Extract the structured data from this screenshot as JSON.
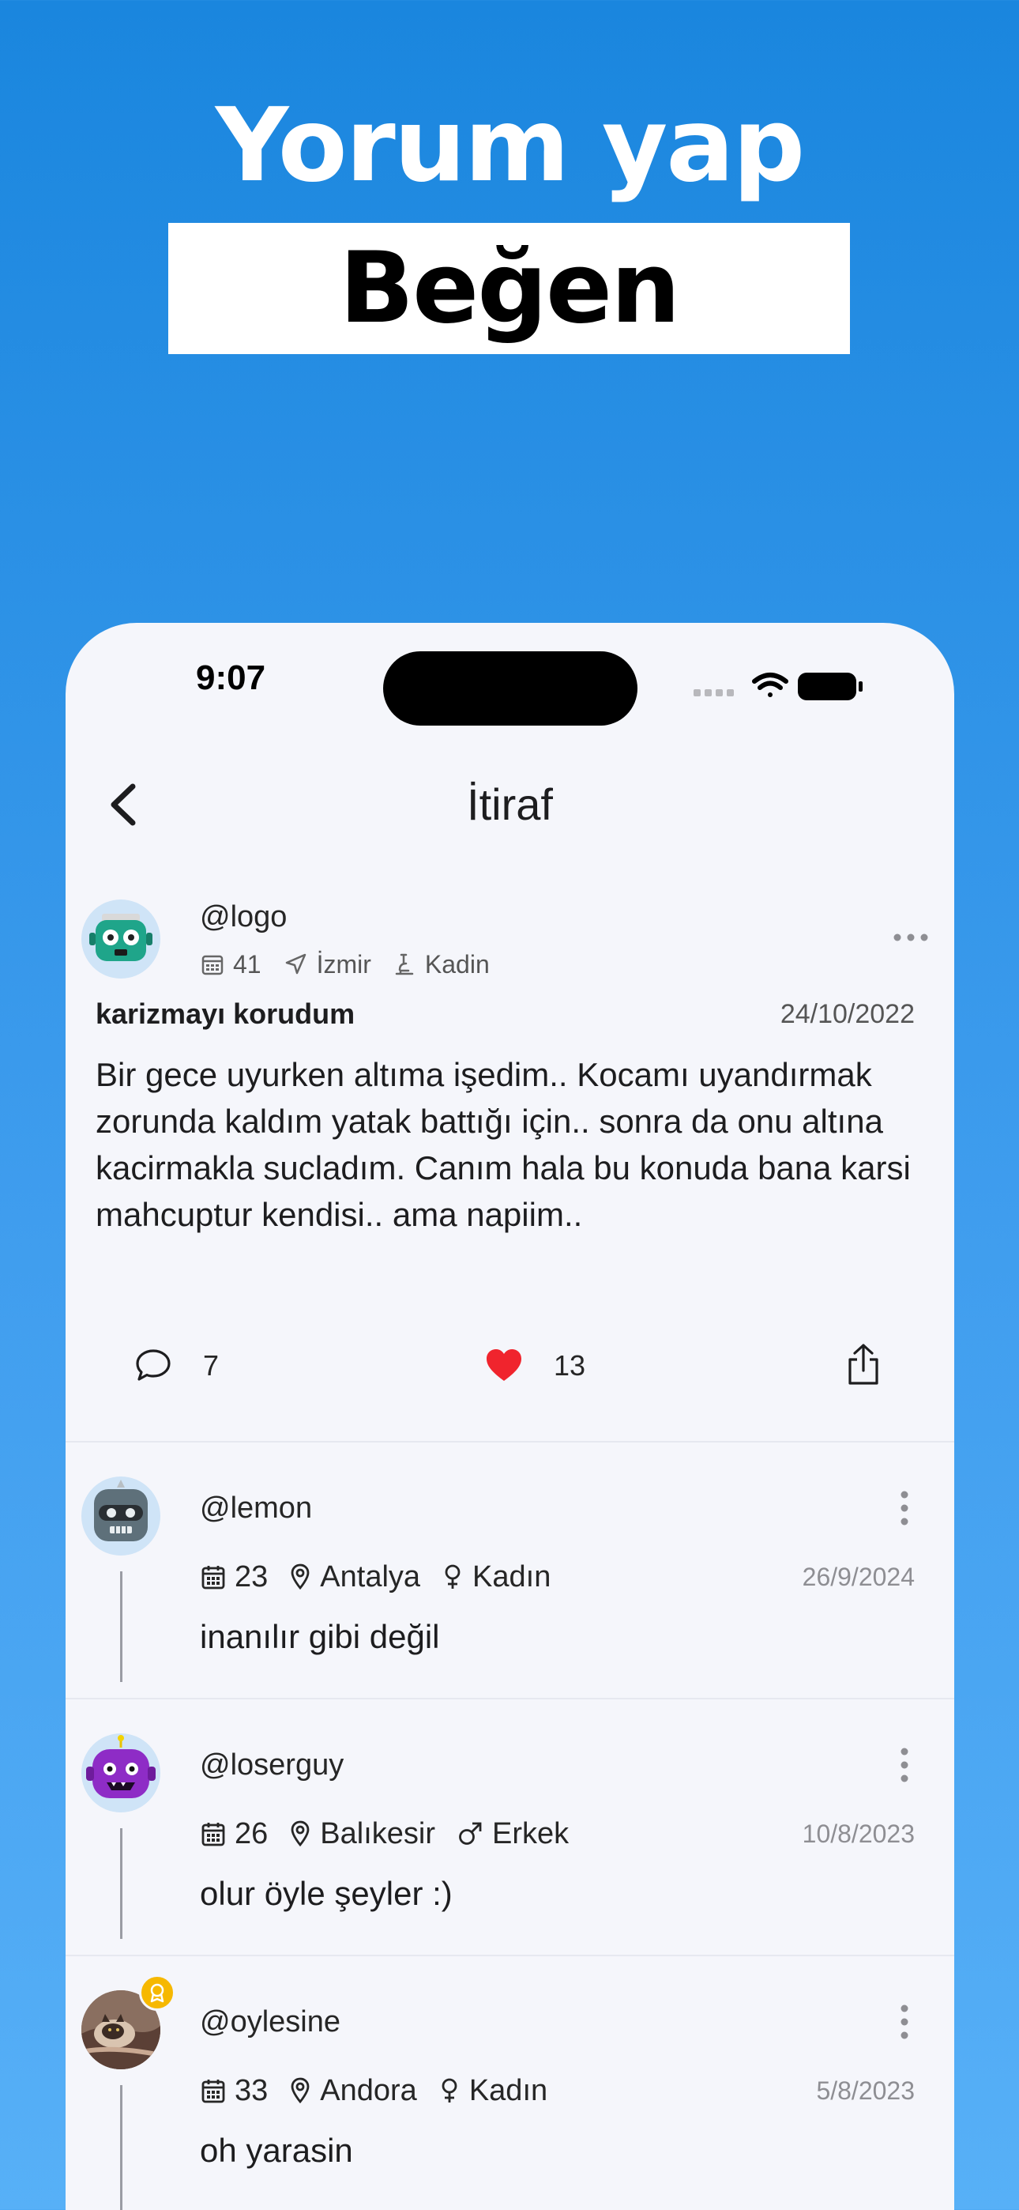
{
  "promo": {
    "title": "Yorum yap",
    "subtitle": "Beğen"
  },
  "status_bar": {
    "time": "9:07"
  },
  "nav": {
    "title": "İtiraf"
  },
  "post": {
    "username": "@logo",
    "age": "41",
    "city": "İzmir",
    "gender": "Kadin",
    "title": "karizmayı korudum",
    "date": "24/10/2022",
    "body": "Bir gece uyurken altıma işedim.. Kocamı uyandırmak zorunda kaldım yatak battığı için.. sonra da onu altına kacirmakla sucladım. Canım hala bu konuda bana karsi mahcuptur kendisi.. ama napiim..",
    "comment_count": "7",
    "like_count": "13",
    "like_color": "#f0242d"
  },
  "comments": [
    {
      "username": "@lemon",
      "age": "23",
      "city": "Antalya",
      "gender": "Kadın",
      "date": "26/9/2024",
      "text": "inanılır gibi değil",
      "gender_icon": "female-icon"
    },
    {
      "username": "@loserguy",
      "age": "26",
      "city": "Balıkesir",
      "gender": "Erkek",
      "date": "10/8/2023",
      "text": "olur öyle şeyler :)",
      "gender_icon": "male-icon"
    },
    {
      "username": "@oylesine",
      "age": "33",
      "city": "Andora",
      "gender": "Kadın",
      "date": "5/8/2023",
      "text": "oh yarasin",
      "gender_icon": "female-icon"
    }
  ]
}
